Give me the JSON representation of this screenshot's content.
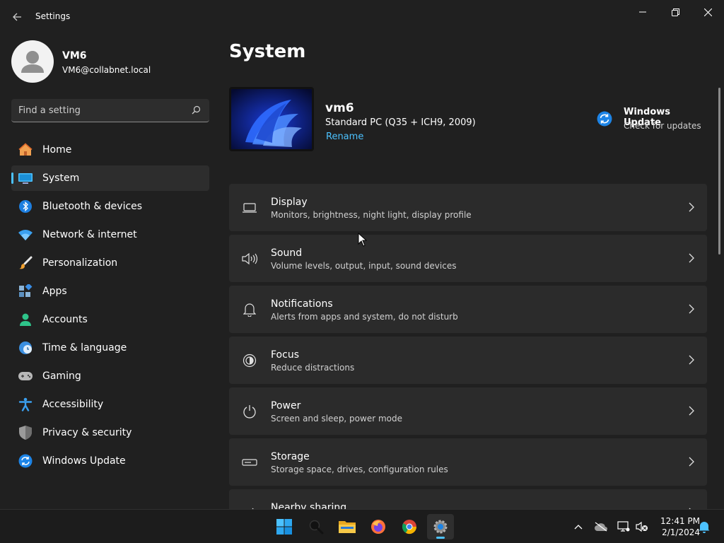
{
  "window": {
    "title": "Settings"
  },
  "user": {
    "name": "VM6",
    "email": "VM6@collabnet.local"
  },
  "search": {
    "placeholder": "Find a setting"
  },
  "nav": [
    {
      "label": "Home",
      "icon": "home-icon"
    },
    {
      "label": "System",
      "icon": "system-icon",
      "active": true
    },
    {
      "label": "Bluetooth & devices",
      "icon": "bluetooth-icon"
    },
    {
      "label": "Network & internet",
      "icon": "wifi-icon"
    },
    {
      "label": "Personalization",
      "icon": "paintbrush-icon"
    },
    {
      "label": "Apps",
      "icon": "apps-icon"
    },
    {
      "label": "Accounts",
      "icon": "accounts-icon"
    },
    {
      "label": "Time & language",
      "icon": "clock-globe-icon"
    },
    {
      "label": "Gaming",
      "icon": "gamepad-icon"
    },
    {
      "label": "Accessibility",
      "icon": "accessibility-icon"
    },
    {
      "label": "Privacy & security",
      "icon": "shield-icon"
    },
    {
      "label": "Windows Update",
      "icon": "windows-update-icon"
    }
  ],
  "main": {
    "title": "System",
    "device": {
      "name": "vm6",
      "model": "Standard PC (Q35 + ICH9, 2009)",
      "rename": "Rename"
    },
    "update": {
      "title": "Windows Update",
      "subtitle": "Check for updates"
    },
    "cards": [
      {
        "title": "Display",
        "subtitle": "Monitors, brightness, night light, display profile",
        "icon": "monitor-icon"
      },
      {
        "title": "Sound",
        "subtitle": "Volume levels, output, input, sound devices",
        "icon": "speaker-icon"
      },
      {
        "title": "Notifications",
        "subtitle": "Alerts from apps and system, do not disturb",
        "icon": "bell-icon"
      },
      {
        "title": "Focus",
        "subtitle": "Reduce distractions",
        "icon": "focus-icon"
      },
      {
        "title": "Power",
        "subtitle": "Screen and sleep, power mode",
        "icon": "power-icon"
      },
      {
        "title": "Storage",
        "subtitle": "Storage space, drives, configuration rules",
        "icon": "storage-icon"
      },
      {
        "title": "Nearby sharing",
        "subtitle": "",
        "icon": "share-icon"
      }
    ]
  },
  "taskbar": {
    "apps": [
      "start-icon",
      "search-icon",
      "file-explorer-icon",
      "firefox-icon",
      "chrome-icon",
      "settings-icon"
    ],
    "time": "12:41 PM",
    "date": "2/1/2024"
  },
  "colors": {
    "accent": "#4cc2ff",
    "background": "#202020",
    "card": "#2b2b2b"
  }
}
